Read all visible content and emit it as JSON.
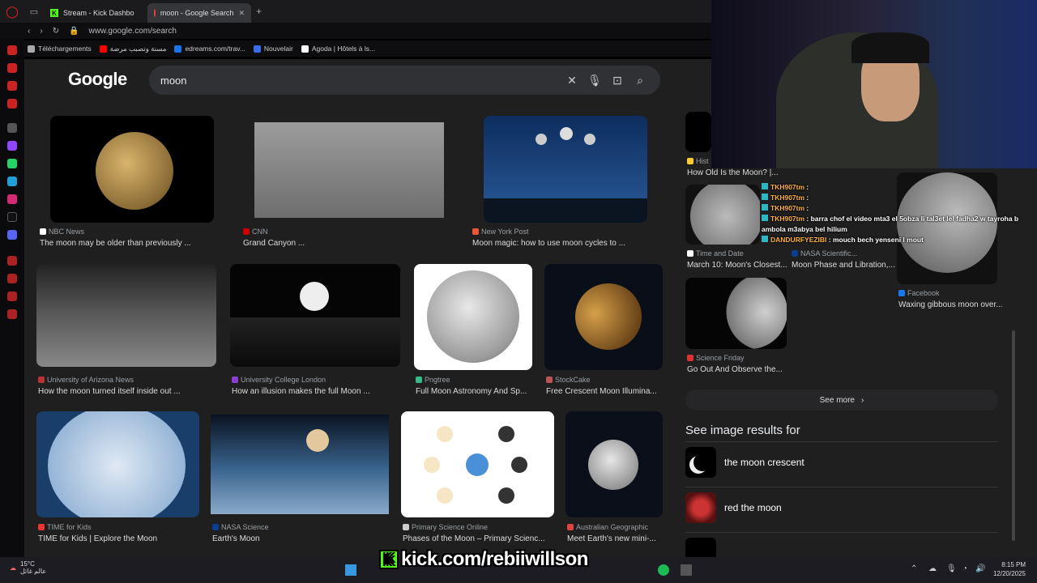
{
  "tabs": [
    {
      "label": "Stream - Kick Dashbo",
      "active": false
    },
    {
      "label": "moon - Google Search",
      "active": true
    }
  ],
  "address": {
    "url": "www.google.com/search"
  },
  "bookmarks": [
    "Téléchargements",
    "مسنة وتصبب مرضة",
    "edreams.com/trav...",
    "Nouvelair",
    "Agoda | Hôtels à ls..."
  ],
  "search": {
    "logo": "Google",
    "query": "moon"
  },
  "results": [
    {
      "source": "NBC News",
      "title": "The moon may be older than previously ..."
    },
    {
      "source": "CNN",
      "title": "Grand Canyon ..."
    },
    {
      "source": "New York Post",
      "title": "Moon magic: how to use moon cycles to ..."
    },
    {
      "source": "University of Arizona News",
      "title": "How the moon turned itself inside out ..."
    },
    {
      "source": "University College London",
      "title": "How an illusion makes the full Moon ..."
    },
    {
      "source": "Pngtree",
      "title": "Full Moon Astronomy And Sp..."
    },
    {
      "source": "StockCake",
      "title": "Free Crescent Moon Illumina..."
    },
    {
      "source": "TIME for Kids",
      "title": "TIME for Kids | Explore the Moon"
    },
    {
      "source": "NASA Science",
      "title": "Earth's Moon"
    },
    {
      "source": "Primary Science Online",
      "title": "Phases of the Moon – Primary Scienc..."
    },
    {
      "source": "Australian Geographic",
      "title": "Meet Earth's new mini-..."
    }
  ],
  "right_results": [
    {
      "source": "Hist",
      "title": "How Old Is the Moon? |..."
    },
    {
      "source": "Time and Date",
      "title": "March 10: Moon's Closest..."
    },
    {
      "source": "NASA Scientific...",
      "title": "Moon Phase and Libration,..."
    },
    {
      "source": "Facebook",
      "title": "Waxing gibbous moon over..."
    },
    {
      "source": "Science Friday",
      "title": "Go Out And Observe the..."
    }
  ],
  "see_more": "See more",
  "see_image_results": "See image results for",
  "related": [
    "the moon crescent",
    "red the moon"
  ],
  "chat": [
    {
      "user": "TKH907tm",
      "text": ":"
    },
    {
      "user": "TKH907tm",
      "text": ":"
    },
    {
      "user": "TKH907tm",
      "text": ":"
    },
    {
      "user": "TKH907tm",
      "text": ": barra chof el video mta3 el 5obza li tal3et lel fadha2 w tayroha b"
    },
    {
      "user": "",
      "text": "ambola m3abya bel hilium"
    },
    {
      "user": "DANDURFYEZIBI",
      "text": ": mouch bech yenseni I mout"
    }
  ],
  "overlay": {
    "kick_url": "kick.com/rebiiwillson"
  },
  "taskbar": {
    "temp": "15°C",
    "weather_label": "عالم غائل",
    "time": "8:15 PM",
    "date": "12/20/2025"
  },
  "colors": {
    "accent": "#53fc18",
    "background": "#1f1f1f"
  }
}
